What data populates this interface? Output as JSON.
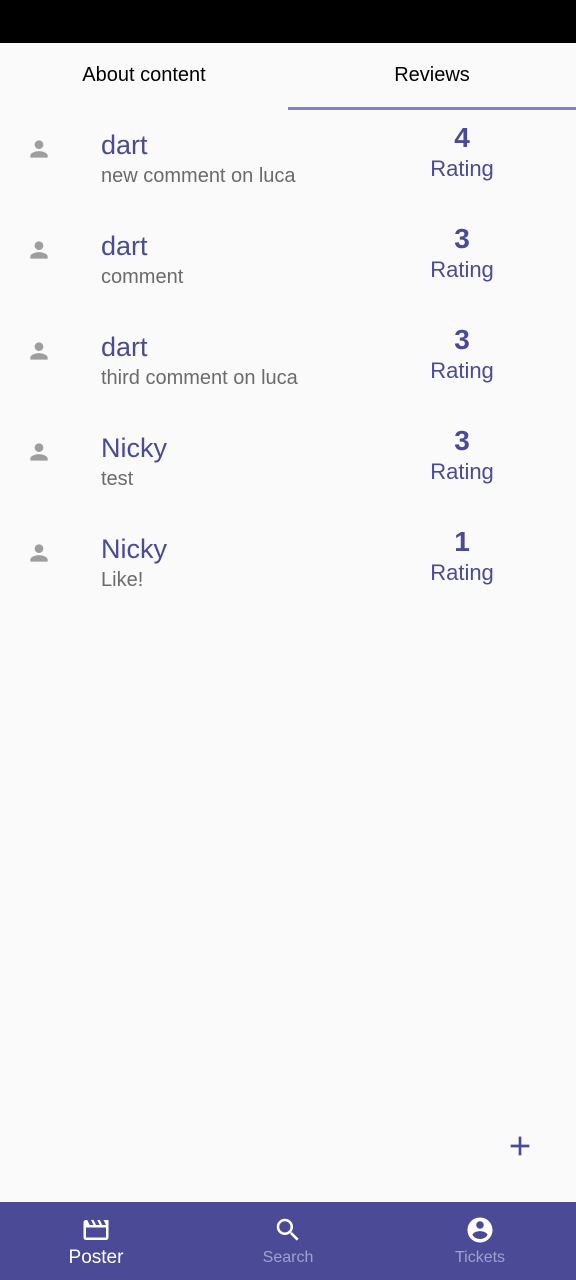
{
  "tabs": {
    "about_label": "About content",
    "reviews_label": "Reviews",
    "active": "Reviews"
  },
  "reviews": [
    {
      "name": "dart",
      "comment": "new comment on luca",
      "rating": "4",
      "rating_label": "Rating"
    },
    {
      "name": "dart",
      "comment": "comment",
      "rating": "3",
      "rating_label": "Rating"
    },
    {
      "name": "dart",
      "comment": "third comment on luca",
      "rating": "3",
      "rating_label": "Rating"
    },
    {
      "name": "Nicky",
      "comment": "test",
      "rating": "3",
      "rating_label": "Rating"
    },
    {
      "name": "Nicky",
      "comment": "Like!",
      "rating": "1",
      "rating_label": "Rating"
    }
  ],
  "fab": {
    "icon": "add-icon"
  },
  "bottom_nav": {
    "items": [
      {
        "label": "Poster",
        "icon": "movie-icon",
        "active": true
      },
      {
        "label": "Search",
        "icon": "search-icon",
        "active": false
      },
      {
        "label": "Tickets",
        "icon": "account-circle-icon",
        "active": false
      }
    ]
  },
  "colors": {
    "primary": "#4a4a96",
    "tab_indicator": "#7f85c4",
    "background": "#fafafa",
    "secondary_text": "#6b6b6b",
    "avatar": "#9e9e9e"
  }
}
